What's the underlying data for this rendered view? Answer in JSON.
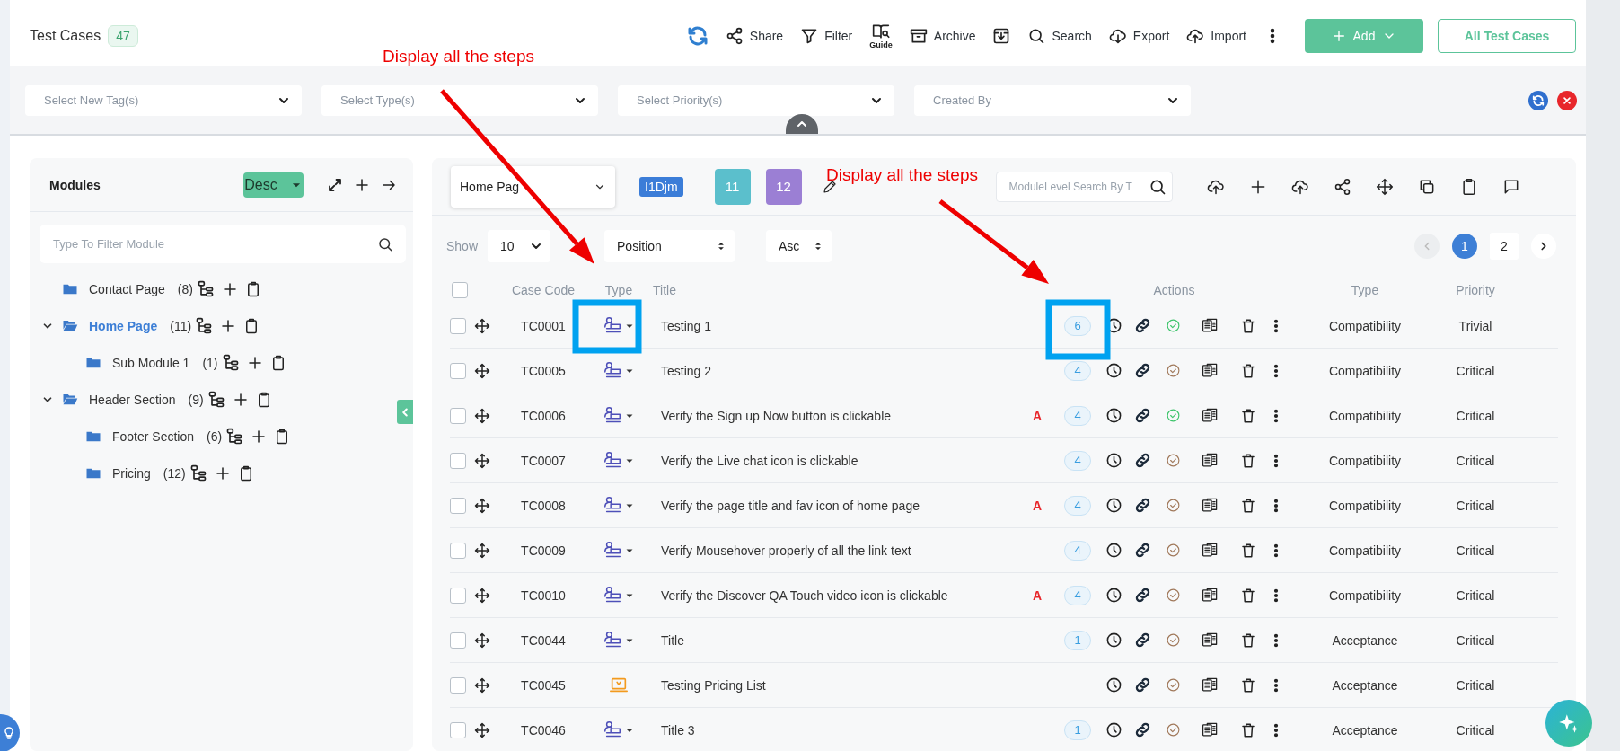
{
  "header": {
    "title": "Test Cases",
    "count": "47",
    "tools": [
      {
        "kind": "refresh"
      },
      {
        "kind": "share",
        "label": "Share"
      },
      {
        "kind": "filter",
        "label": "Filter"
      },
      {
        "kind": "guide",
        "label": "Guide"
      },
      {
        "kind": "archive",
        "label": "Archive"
      },
      {
        "kind": "download"
      },
      {
        "kind": "search",
        "label": "Search"
      },
      {
        "kind": "export",
        "label": "Export"
      },
      {
        "kind": "import",
        "label": "Import"
      },
      {
        "kind": "more"
      }
    ],
    "add_button": "Add",
    "all_button": "All Test Cases"
  },
  "filters": [
    {
      "placeholder": "Select New Tag(s)"
    },
    {
      "placeholder": "Select Type(s)"
    },
    {
      "placeholder": "Select Priority(s)"
    },
    {
      "placeholder": "Created By"
    }
  ],
  "modules": {
    "title": "Modules",
    "sort": "Desc",
    "filter_placeholder": "Type To Filter Module",
    "tree": [
      {
        "name": "Contact Page",
        "count": "(8)",
        "selected": false,
        "expanded": false
      },
      {
        "name": "Home Page",
        "count": "(11)",
        "selected": true,
        "expanded": true,
        "children": [
          {
            "name": "Sub Module 1",
            "count": "(1)",
            "selected": false,
            "expanded": false
          }
        ]
      },
      {
        "name": "Header Section",
        "count": "(9)",
        "selected": false,
        "expanded": true,
        "children": [
          {
            "name": "Footer Section",
            "count": "(6)",
            "selected": false,
            "expanded": false
          },
          {
            "name": "Pricing",
            "count": "(12)",
            "selected": false,
            "expanded": false
          }
        ]
      }
    ]
  },
  "panel": {
    "module_select": "Home Pag",
    "tag": "I1Djm",
    "counts": [
      {
        "label": "11",
        "color": "#5bbfcc"
      },
      {
        "label": "12",
        "color": "#9b7fd4"
      }
    ],
    "search_placeholder": "ModuleLevel Search By T",
    "show_label": "Show",
    "page_size": "10",
    "sort_field": "Position",
    "sort_order": "Asc",
    "prev_disabled": true,
    "pages": [
      {
        "label": "1",
        "selected": true
      },
      {
        "label": "2",
        "selected": false
      }
    ]
  },
  "table": {
    "all_checked": false,
    "columns": [
      "Case Code",
      "Type",
      "Title",
      "Actions",
      "Type",
      "Priority"
    ],
    "rows": [
      {
        "checked": false,
        "code": "TC0001",
        "kind": "manual",
        "title": "Testing 1",
        "steps": "6",
        "color": "#3cc46a",
        "type": "Compatibility",
        "priority": "Trivial"
      },
      {
        "checked": false,
        "code": "TC0005",
        "kind": "manual",
        "title": "Testing 2",
        "steps": "4",
        "color": "#a0785a",
        "type": "Compatibility",
        "priority": "Critical"
      },
      {
        "checked": false,
        "code": "TC0006",
        "kind": "manual",
        "title": "Verify the Sign up Now button is clickable",
        "flag": "A",
        "steps": "4",
        "color": "#3cc46a",
        "type": "Compatibility",
        "priority": "Critical"
      },
      {
        "checked": false,
        "code": "TC0007",
        "kind": "manual",
        "title": "Verify the Live chat icon is clickable",
        "steps": "4",
        "color": "#a0785a",
        "type": "Compatibility",
        "priority": "Critical"
      },
      {
        "checked": false,
        "code": "TC0008",
        "kind": "manual",
        "title": "Verify the page title and fav icon of home page",
        "flag": "A",
        "steps": "4",
        "color": "#a0785a",
        "type": "Compatibility",
        "priority": "Critical"
      },
      {
        "checked": false,
        "code": "TC0009",
        "kind": "manual",
        "title": "Verify Mousehover properly of all the link text",
        "steps": "4",
        "color": "#a0785a",
        "type": "Compatibility",
        "priority": "Critical"
      },
      {
        "checked": false,
        "code": "TC0010",
        "kind": "manual",
        "title": "Verify the Discover QA Touch video icon is clickable",
        "flag": "A",
        "steps": "4",
        "color": "#a0785a",
        "type": "Compatibility",
        "priority": "Critical"
      },
      {
        "checked": false,
        "code": "TC0044",
        "kind": "manual",
        "title": "Title",
        "steps": "1",
        "color": "#a0785a",
        "type": "Acceptance",
        "priority": "Critical"
      },
      {
        "checked": false,
        "code": "TC0045",
        "kind": "screen",
        "title": "Testing Pricing List",
        "color": "#a0785a",
        "type": "Acceptance",
        "priority": "Critical"
      },
      {
        "checked": false,
        "code": "TC0046",
        "kind": "manual",
        "title": "Title 3",
        "steps": "1",
        "color": "#a0785a",
        "type": "Acceptance",
        "priority": "Critical"
      }
    ]
  },
  "annotations": [
    {
      "text": "Display all the steps"
    },
    {
      "text": "Display all the steps"
    }
  ]
}
